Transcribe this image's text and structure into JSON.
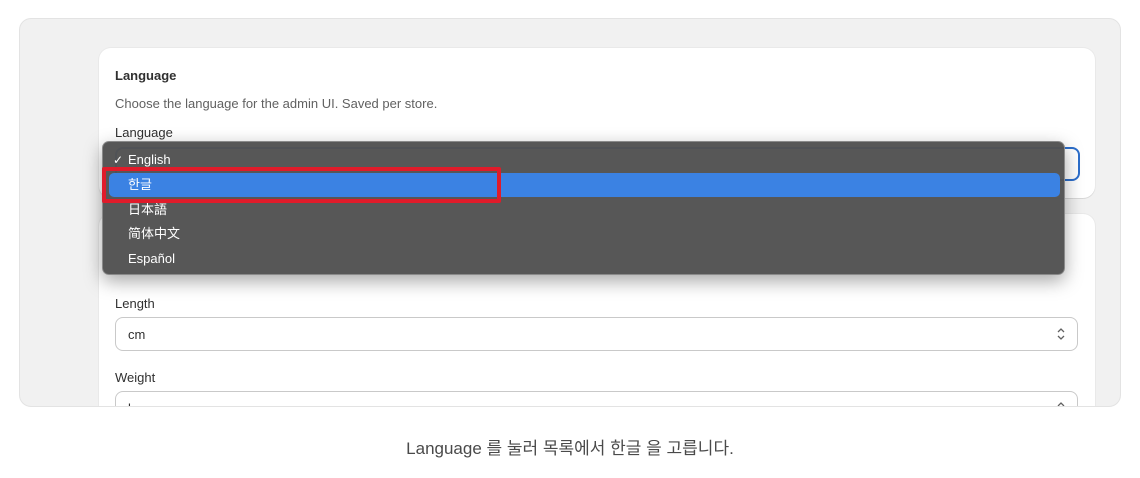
{
  "language_card": {
    "title": "Language",
    "description": "Choose the language for the admin UI. Saved per store.",
    "field_label": "Language",
    "selected_value": "English",
    "options": [
      {
        "label": "English",
        "checked": true
      },
      {
        "label": "한글",
        "highlighted": true
      },
      {
        "label": "日本語"
      },
      {
        "label": "简体中文"
      },
      {
        "label": "Español"
      }
    ],
    "check_glyph": "✓"
  },
  "units_card": {
    "length_label": "Length",
    "length_value": "cm",
    "weight_label": "Weight",
    "weight_value": "kg"
  },
  "caption": "Language 를 눌러 목록에서 한글 을 고릅니다.",
  "icons": {
    "select_chevron": "chevron-up-down-icon",
    "checkmark": "checkmark-icon"
  },
  "colors": {
    "focus_blue": "#2c6ecb",
    "menu_bg": "#525252",
    "menu_highlight": "#3b82e3",
    "annotation_red": "#e01b2a"
  }
}
